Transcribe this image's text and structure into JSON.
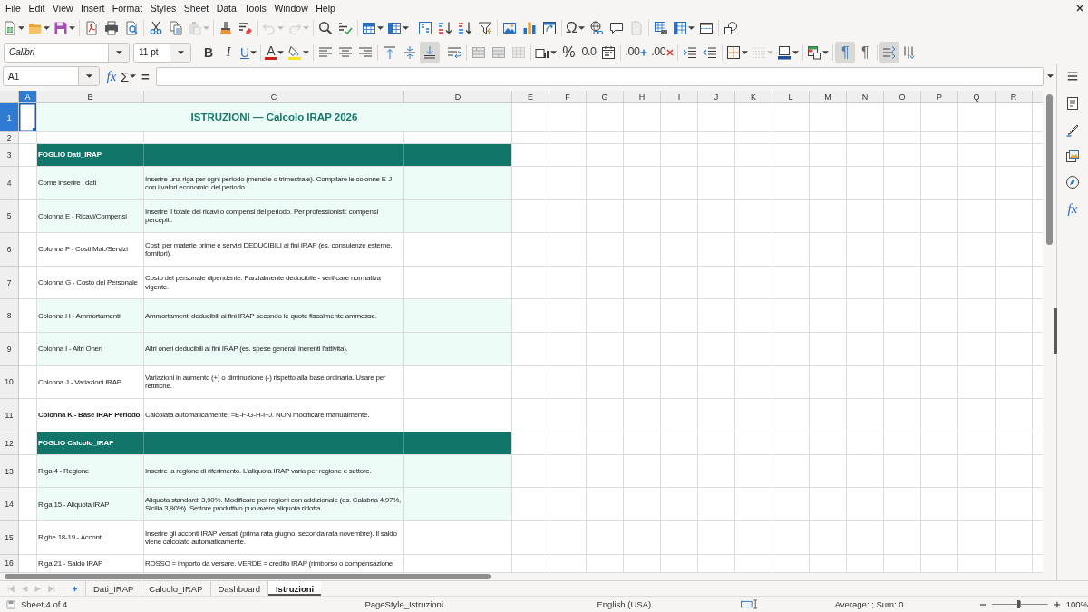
{
  "menu_bar": {
    "items": [
      "File",
      "Edit",
      "View",
      "Insert",
      "Format",
      "Styles",
      "Sheet",
      "Data",
      "Tools",
      "Window",
      "Help"
    ]
  },
  "standard_toolbar": {
    "groups": [
      [
        {
          "kind": "new-spreadsheet",
          "disabled": false
        },
        {
          "kind": "open",
          "disabled": false
        },
        {
          "kind": "save",
          "disabled": false
        }
      ],
      [
        {
          "kind": "export-pdf",
          "disabled": false
        },
        {
          "kind": "print",
          "disabled": false
        },
        {
          "kind": "print-preview",
          "disabled": false
        }
      ],
      [
        {
          "kind": "cut",
          "disabled": false
        },
        {
          "kind": "copy",
          "disabled": false
        },
        {
          "kind": "paste",
          "disabled": true
        }
      ],
      [
        {
          "kind": "clone-formatting",
          "disabled": false
        },
        {
          "kind": "clear-formatting",
          "disabled": false
        }
      ],
      [
        {
          "kind": "undo",
          "disabled": true
        },
        {
          "kind": "redo",
          "disabled": true
        }
      ],
      [
        {
          "kind": "find-replace",
          "disabled": false
        },
        {
          "kind": "spelling",
          "disabled": false
        }
      ],
      [
        {
          "kind": "row",
          "disabled": false
        },
        {
          "kind": "column",
          "disabled": false
        }
      ],
      [
        {
          "kind": "sort",
          "disabled": false
        },
        {
          "kind": "sort-ascending",
          "disabled": false
        },
        {
          "kind": "sort-descending",
          "disabled": false
        },
        {
          "kind": "autofilter",
          "disabled": false
        }
      ],
      [
        {
          "kind": "image",
          "disabled": false
        },
        {
          "kind": "chart",
          "disabled": false
        },
        {
          "kind": "pivot-table",
          "disabled": false
        }
      ],
      [
        {
          "kind": "special-character",
          "text": "Ω",
          "disabled": false
        },
        {
          "kind": "hyperlink",
          "disabled": false
        },
        {
          "kind": "comment",
          "disabled": false
        },
        {
          "kind": "headers-footers",
          "disabled": true
        }
      ],
      [
        {
          "kind": "print-area",
          "disabled": false
        },
        {
          "kind": "freeze",
          "disabled": false
        },
        {
          "kind": "split-window",
          "disabled": false
        }
      ],
      [
        {
          "kind": "shapes",
          "disabled": false
        }
      ]
    ]
  },
  "formatting_toolbar": {
    "font_name": "Calibri",
    "font_size": "11 pt",
    "groups": [
      [
        {
          "kind": "bold",
          "text": "B",
          "on": false,
          "disabled": false
        },
        {
          "kind": "italic",
          "text": "I",
          "on": false,
          "disabled": false
        },
        {
          "kind": "underline",
          "text": "U",
          "on": false,
          "disabled": false
        }
      ],
      [
        {
          "kind": "font-color",
          "text": "A",
          "on": false,
          "disabled": false
        },
        {
          "kind": "highlighting",
          "on": false,
          "disabled": false
        }
      ],
      [
        {
          "kind": "align-left",
          "on": false,
          "disabled": false
        },
        {
          "kind": "align-center",
          "on": false,
          "disabled": false
        },
        {
          "kind": "align-right",
          "on": false,
          "disabled": false
        }
      ],
      [
        {
          "kind": "align-top",
          "on": false,
          "disabled": false
        },
        {
          "kind": "align-middle",
          "on": false,
          "disabled": false
        },
        {
          "kind": "align-bottom",
          "on": true,
          "disabled": false
        }
      ],
      [
        {
          "kind": "wrap-text",
          "on": false,
          "disabled": false
        }
      ],
      [
        {
          "kind": "merge-center",
          "on": false,
          "disabled": false
        },
        {
          "kind": "merge",
          "on": false,
          "disabled": false
        },
        {
          "kind": "unmerge",
          "on": false,
          "disabled": true
        }
      ],
      [
        {
          "kind": "number-format",
          "on": false,
          "disabled": false
        },
        {
          "kind": "percent",
          "text": "%",
          "on": false,
          "disabled": false
        },
        {
          "kind": "standard-format",
          "text": "0.0",
          "on": false,
          "disabled": false
        },
        {
          "kind": "date",
          "on": false,
          "disabled": false
        }
      ],
      [
        {
          "kind": "add-decimal",
          "text": ".00",
          "on": false,
          "disabled": false
        },
        {
          "kind": "delete-decimal",
          "text": ".00",
          "on": false,
          "disabled": false
        }
      ],
      [
        {
          "kind": "increase-indent",
          "on": false,
          "disabled": false
        },
        {
          "kind": "decrease-indent",
          "on": false,
          "disabled": false
        }
      ],
      [
        {
          "kind": "borders",
          "on": false,
          "disabled": false
        },
        {
          "kind": "border-style",
          "on": false,
          "disabled": true
        },
        {
          "kind": "border-color",
          "on": false,
          "disabled": false
        }
      ],
      [
        {
          "kind": "conditional",
          "on": false,
          "disabled": false
        }
      ],
      [
        {
          "kind": "left-to-right",
          "text": "¶",
          "on": true,
          "disabled": false
        },
        {
          "kind": "right-to-left",
          "text": "¶",
          "on": false,
          "disabled": false
        }
      ],
      [
        {
          "kind": "text-left-to-right",
          "on": true,
          "disabled": false
        },
        {
          "kind": "vertical-text",
          "on": false,
          "disabled": false
        }
      ]
    ]
  },
  "formula_bar": {
    "name_box": "A1",
    "buttons": [
      {
        "kind": "function-wizard",
        "text": "fx"
      },
      {
        "kind": "sum",
        "text": "Σ"
      },
      {
        "kind": "formula",
        "text": "="
      }
    ]
  },
  "sidebar": {
    "buttons": [
      {
        "kind": "properties"
      },
      {
        "kind": "styles"
      },
      {
        "kind": "gallery"
      },
      {
        "kind": "navigator"
      },
      {
        "kind": "functions",
        "text": "fx"
      }
    ]
  },
  "sheet": {
    "columns": [
      {
        "label": "A",
        "selected": true
      },
      {
        "label": "B",
        "selected": false
      },
      {
        "label": "C",
        "selected": false
      },
      {
        "label": "D",
        "selected": false
      },
      {
        "label": "E",
        "selected": false
      },
      {
        "label": "F",
        "selected": false
      },
      {
        "label": "G",
        "selected": false
      },
      {
        "label": "H",
        "selected": false
      },
      {
        "label": "I",
        "selected": false
      },
      {
        "label": "J",
        "selected": false
      },
      {
        "label": "K",
        "selected": false
      },
      {
        "label": "L",
        "selected": false
      },
      {
        "label": "M",
        "selected": false
      },
      {
        "label": "N",
        "selected": false
      },
      {
        "label": "O",
        "selected": false
      },
      {
        "label": "P",
        "selected": false
      },
      {
        "label": "Q",
        "selected": false
      },
      {
        "label": "R",
        "selected": false
      }
    ],
    "rows": [
      {
        "number": "1",
        "kind": "title",
        "selected": true,
        "title": "ISTRUZIONI — Calcolo IRAP 2026"
      },
      {
        "number": "2",
        "kind": "blank",
        "selected": false
      },
      {
        "number": "3",
        "kind": "section",
        "selected": false,
        "text": "FOGLIO Dati_IRAP"
      },
      {
        "number": "4",
        "kind": "entry",
        "selected": false,
        "shaded": true,
        "bold": false,
        "label": "Come inserire i dati",
        "description": "Inserire una riga per ogni periodo (mensile o trimestrale). Compilare le colonne E-J con i valori economici del periodo."
      },
      {
        "number": "5",
        "kind": "entry",
        "selected": false,
        "shaded": true,
        "bold": false,
        "label": "Colonna E - Ricavi/Compensi",
        "description": "Inserire il totale dei ricavi o compensi del periodo. Per professionisti: compensi percepiti."
      },
      {
        "number": "6",
        "kind": "entry",
        "selected": false,
        "shaded": false,
        "bold": false,
        "label": "Colonna F - Costi Mat./Servizi",
        "description": "Costi per materie prime e servizi DEDUCIBILI ai fini IRAP (es. consulenze esterne, fornitori)."
      },
      {
        "number": "7",
        "kind": "entry",
        "selected": false,
        "shaded": false,
        "bold": false,
        "label": "Colonna G - Costo del Personale",
        "description": "Costo del personale dipendente. Parzialmente deducibile - verificare normativa vigente."
      },
      {
        "number": "8",
        "kind": "entry",
        "selected": false,
        "shaded": true,
        "bold": false,
        "label": "Colonna H - Ammortamenti",
        "description": "Ammortamenti deducibili ai fini IRAP secondo le quote fiscalmente ammesse."
      },
      {
        "number": "9",
        "kind": "entry",
        "selected": false,
        "shaded": true,
        "bold": false,
        "label": "Colonna I - Altri Oneri",
        "description": "Altri oneri deducibili ai fini IRAP (es. spese generali inerenti l'attivita)."
      },
      {
        "number": "10",
        "kind": "entry",
        "selected": false,
        "shaded": false,
        "bold": false,
        "label": "Colonna J - Variazioni IRAP",
        "description": "Variazioni in aumento (+) o diminuzione (-) rispetto alla base ordinaria. Usare per rettifiche."
      },
      {
        "number": "11",
        "kind": "entry",
        "selected": false,
        "shaded": false,
        "bold": true,
        "label": "Colonna K - Base IRAP Periodo",
        "description": "Calcolata automaticamente: =E-F-G-H-I+J. NON modificare manualmente."
      },
      {
        "number": "12",
        "kind": "section",
        "selected": false,
        "text": "FOGLIO Calcolo_IRAP"
      },
      {
        "number": "13",
        "kind": "entry",
        "selected": false,
        "shaded": true,
        "bold": false,
        "label": "Riga 4 - Regione",
        "description": "Inserire la regione di riferimento. L'aliquota IRAP varia per regione e settore."
      },
      {
        "number": "14",
        "kind": "entry",
        "selected": false,
        "shaded": true,
        "bold": false,
        "label": "Riga 15 - Aliquota IRAP",
        "description": "Aliquota standard: 3,90%. Modificare per regioni con addizionale (es. Calabria 4,97%, Sicilia 3,90%). Settore produttivo puo avere aliquota ridotta."
      },
      {
        "number": "15",
        "kind": "entry",
        "selected": false,
        "shaded": false,
        "bold": false,
        "label": "Righe 18-19 - Acconti",
        "description": "Inserire gli acconti IRAP versati (prima rata giugno, seconda rata novembre). Il saldo viene calcolato automaticamente."
      },
      {
        "number": "16",
        "kind": "entry",
        "selected": false,
        "shaded": false,
        "bold": false,
        "label": "Riga 21 - Saldo IRAP",
        "description": "ROSSO = importo da versare. VERDE = credito IRAP (rimborso o compensazione"
      }
    ]
  },
  "sheet_tabs": {
    "tabs": [
      {
        "label": "Dati_IRAP",
        "selected": false
      },
      {
        "label": "Calcolo_IRAP",
        "selected": false
      },
      {
        "label": "Dashboard",
        "selected": false
      },
      {
        "label": "Istruzioni",
        "selected": true
      }
    ]
  },
  "status_bar": {
    "sheet_position": "Sheet 4 of 4",
    "page_style": "PageStyle_Istruzioni",
    "language": "English (USA)",
    "selection_summary": "Average: ; Sum: 0",
    "zoom": {
      "level": 0.47,
      "reading": "100%"
    }
  }
}
